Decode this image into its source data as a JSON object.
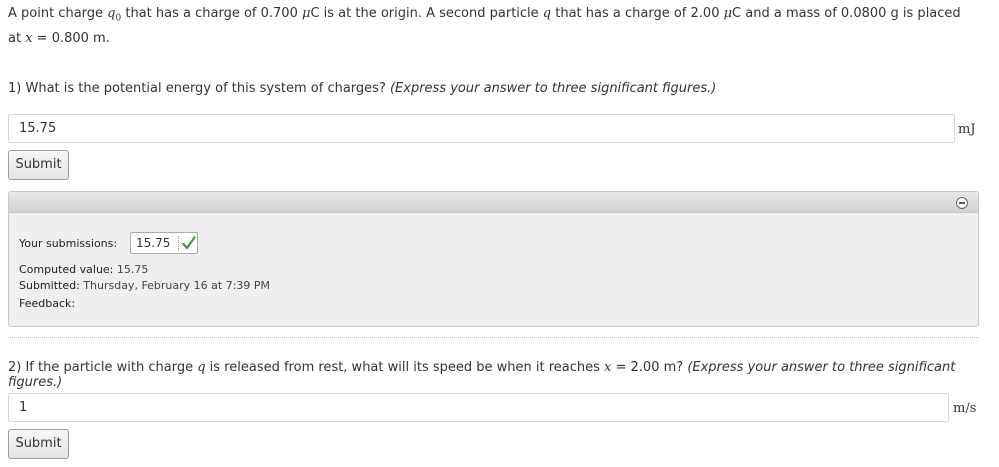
{
  "intro": {
    "t1": "A point charge ",
    "var_q0": "q",
    "sub_0": "0",
    "t2": " that has a charge of 0.700 ",
    "mu1": "μ",
    "t3": "C is at the origin. A second particle ",
    "var_q": "q",
    "t4": " that has a charge of 2.00 ",
    "mu2": "μ",
    "t5": "C and a mass of 0.0800 g is placed at ",
    "var_x": "x",
    "t6": " = 0.800 m."
  },
  "question1": {
    "text": "1) What is the potential energy of this system of charges?",
    "hint": "(Express your answer to three significant figures.)",
    "input_value": "15.75",
    "unit": "mJ",
    "submit_label": "Submit"
  },
  "submissions_panel": {
    "label": "Your submissions:",
    "submitted_value": "15.75",
    "status": "correct",
    "status_color": "#3a9b3a",
    "computed_label": "Computed value:",
    "computed_value": "15.75",
    "submitted_label": "Submitted:",
    "submitted_time": "Thursday, February 16 at 7:39 PM",
    "feedback_label": "Feedback:",
    "toggle_icon": "collapse-icon"
  },
  "question2": {
    "t1": "2) If the particle with charge ",
    "var_q": "q",
    "t2": " is released from rest, what will its speed be when it reaches ",
    "var_x": "x",
    "t3": " = 2.00 m?",
    "hint": "(Express your answer to three significant figures.)",
    "input_value": "1",
    "unit": "m/s",
    "submit_label": "Submit"
  }
}
